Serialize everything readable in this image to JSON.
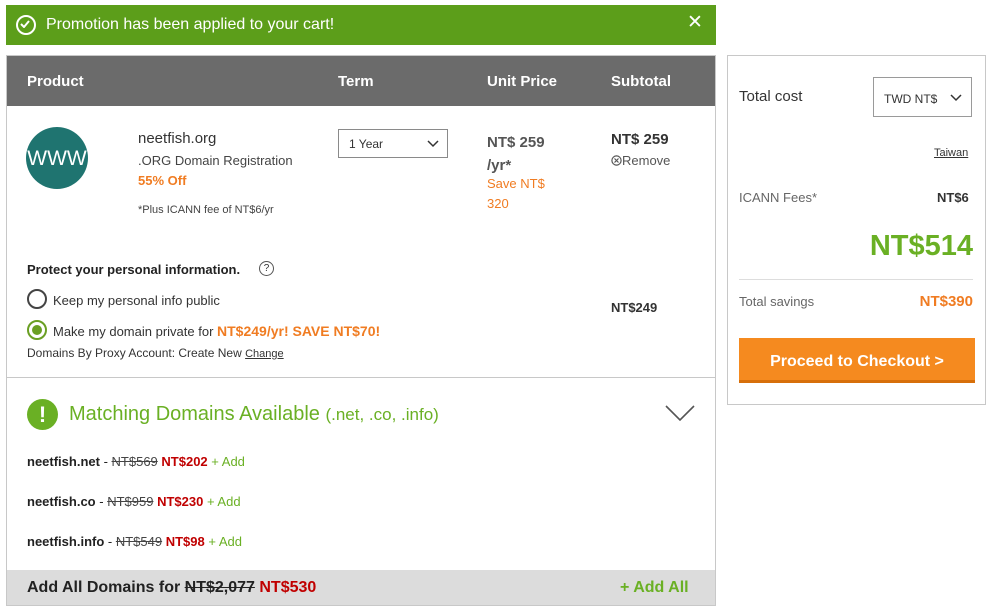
{
  "promo_banner": {
    "message": "Promotion has been applied to your cart!",
    "close_symbol": "✕",
    "color": "#5c9e1a"
  },
  "table": {
    "headers": {
      "product": "Product",
      "term": "Term",
      "unit_price": "Unit Price",
      "subtotal": "Subtotal"
    }
  },
  "item": {
    "icon": "www-icon",
    "icon_text": "WWW",
    "name": "neetfish.org",
    "description": ".ORG Domain Registration",
    "discount": "55% Off",
    "icann_note": "*Plus ICANN fee of NT$6/yr",
    "term_value": "1 Year",
    "unit_price": "NT$ 259 /yr*",
    "save_text": "Save NT$ 320",
    "subtotal": "NT$ 259",
    "remove_label": "Remove"
  },
  "privacy": {
    "heading": "Protect your personal information.",
    "help_symbol": "?",
    "option_public": "Keep my personal info public",
    "option_private_prefix": "Make my domain private for ",
    "option_private_promo": "NT$249/yr! SAVE NT$70!",
    "proxy_text": "Domains By Proxy Account: Create New ",
    "proxy_change": "Change",
    "price": "NT$249",
    "selected": "private"
  },
  "matching": {
    "title": "Matching Domains Available",
    "extensions": "(.net, .co, .info)",
    "icon_symbol": "!",
    "suggestions": [
      {
        "name": "neetfish.net",
        "separator": " - ",
        "old_price": "NT$569",
        "new_price": "NT$202",
        "add_label": "+ Add"
      },
      {
        "name": "neetfish.co",
        "separator": " - ",
        "old_price": "NT$959",
        "new_price": "NT$230",
        "add_label": "+ Add"
      },
      {
        "name": "neetfish.info",
        "separator": " - ",
        "old_price": "NT$549",
        "new_price": "NT$98",
        "add_label": "+ Add"
      }
    ],
    "add_all_label": "Add All Domains for ",
    "add_all_old": "NT$2,077",
    "add_all_new": "NT$530",
    "add_all_button": "+ Add All"
  },
  "summary": {
    "title": "Total cost",
    "currency": "TWD NT$",
    "country": "Taiwan",
    "icann_label": "ICANN Fees*",
    "icann_value": "NT$6",
    "total": "NT$514",
    "savings_label": "Total savings",
    "savings_value": "NT$390",
    "checkout_label": "Proceed to Checkout >",
    "accent_color": "#f58a1f",
    "total_color": "#6ab024"
  }
}
